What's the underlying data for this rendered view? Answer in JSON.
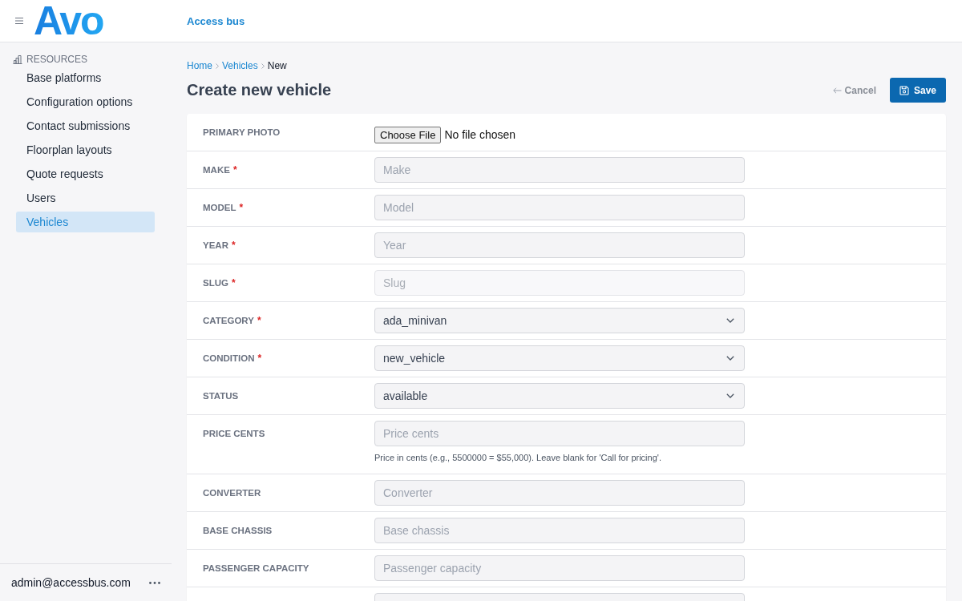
{
  "header": {
    "logo": "Avo",
    "app_name": "Access bus"
  },
  "sidebar": {
    "section": "RESOURCES",
    "items": [
      {
        "label": "Base platforms",
        "selected": false
      },
      {
        "label": "Configuration options",
        "selected": false
      },
      {
        "label": "Contact submissions",
        "selected": false
      },
      {
        "label": "Floorplan layouts",
        "selected": false
      },
      {
        "label": "Quote requests",
        "selected": false
      },
      {
        "label": "Users",
        "selected": false
      },
      {
        "label": "Vehicles",
        "selected": true
      }
    ],
    "user": "admin@accessbus.com"
  },
  "breadcrumb": [
    {
      "label": "Home",
      "kind": "link"
    },
    {
      "label": "Vehicles",
      "kind": "link"
    },
    {
      "label": "New",
      "kind": "current"
    }
  ],
  "page_title": "Create new vehicle",
  "actions": {
    "cancel": "Cancel",
    "save": "Save"
  },
  "form": {
    "fields": [
      {
        "label": "PRIMARY PHOTO",
        "kind": "file",
        "button": "Choose File",
        "value": "No file chosen",
        "disabled": false
      },
      {
        "label": "MAKE",
        "required_mark": "*",
        "kind": "text",
        "placeholder": "Make",
        "disabled": false
      },
      {
        "label": "MODEL",
        "required_mark": "*",
        "kind": "text",
        "placeholder": "Model",
        "disabled": false
      },
      {
        "label": "YEAR",
        "required_mark": "*",
        "kind": "text",
        "placeholder": "Year",
        "disabled": false
      },
      {
        "label": "SLUG",
        "required_mark": "*",
        "kind": "text",
        "placeholder": "Slug",
        "disabled": true
      },
      {
        "label": "CATEGORY",
        "required_mark": "*",
        "kind": "select",
        "value": "ada_minivan",
        "disabled": false
      },
      {
        "label": "CONDITION",
        "required_mark": "*",
        "kind": "select",
        "value": "new_vehicle",
        "disabled": false
      },
      {
        "label": "STATUS",
        "kind": "select",
        "value": "available",
        "disabled": false
      },
      {
        "label": "PRICE CENTS",
        "kind": "text",
        "placeholder": "Price cents",
        "help": "Price in cents (e.g., 5500000 = $55,000). Leave blank for 'Call for pricing'.",
        "disabled": false
      },
      {
        "label": "CONVERTER",
        "kind": "text",
        "placeholder": "Converter",
        "disabled": false
      },
      {
        "label": "BASE CHASSIS",
        "kind": "text",
        "placeholder": "Base chassis",
        "disabled": false
      },
      {
        "label": "PASSENGER CAPACITY",
        "kind": "text",
        "placeholder": "Passenger capacity",
        "disabled": false
      },
      {
        "kind": "text",
        "disabled": false
      }
    ]
  }
}
